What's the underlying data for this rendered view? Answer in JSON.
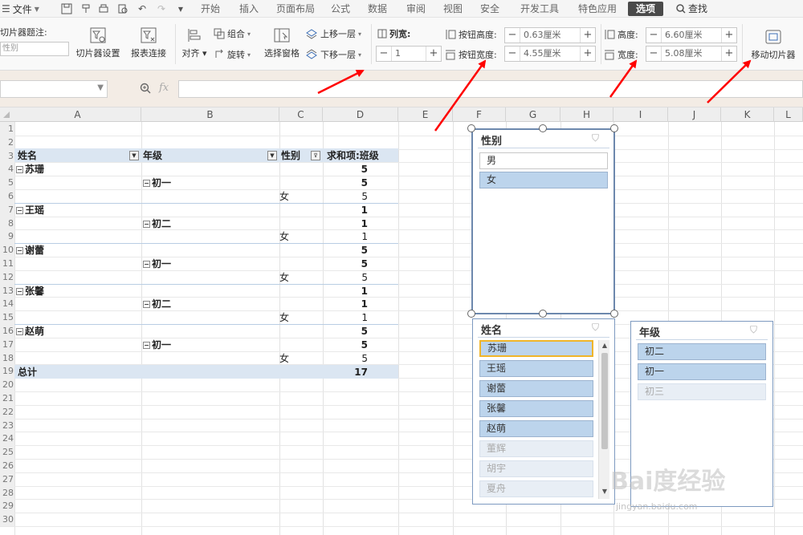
{
  "menubar": {
    "file_label": "文件",
    "tabs": [
      "开始",
      "插入",
      "页面布局",
      "公式",
      "数据",
      "审阅",
      "视图",
      "安全",
      "开发工具",
      "特色应用",
      "选项"
    ],
    "active_tab": "选项",
    "search_label": "查找"
  },
  "ribbon": {
    "caption_label": "切片器题注:",
    "caption_value": "性别",
    "slicer_settings": "切片器设置",
    "report_connections": "报表连接",
    "align": "对齐",
    "group": "组合",
    "rotate": "旋转",
    "selection_pane": "选择窗格",
    "bring_forward": "上移一层",
    "send_backward": "下移一层",
    "columns_label": "列宽:",
    "columns_value": "1",
    "button_height_label": "按钮高度:",
    "button_height_value": "0.63厘米",
    "button_width_label": "按钮宽度:",
    "button_width_value": "4.55厘米",
    "height_label": "高度:",
    "height_value": "6.60厘米",
    "width_label": "宽度:",
    "width_value": "5.08厘米",
    "move_slicer": "移动切片器"
  },
  "formula_bar": {
    "fx": "fx",
    "value": ""
  },
  "columns": [
    "A",
    "B",
    "C",
    "D",
    "E",
    "F",
    "G",
    "H",
    "I",
    "J",
    "K",
    "L"
  ],
  "rows": [
    "1",
    "2",
    "3",
    "4",
    "5",
    "6",
    "7",
    "8",
    "9",
    "10",
    "11",
    "12",
    "13",
    "14",
    "15",
    "16",
    "17",
    "18",
    "19",
    "20",
    "21",
    "22",
    "23",
    "24",
    "25",
    "26",
    "27",
    "28",
    "29",
    "30"
  ],
  "pivot": {
    "headers": [
      "姓名",
      "年级",
      "性别",
      "求和项:班级"
    ],
    "names": [
      {
        "name": "苏珊",
        "total": "5",
        "grade": "初一",
        "grade_total": "5",
        "gender": "女",
        "value": "5"
      },
      {
        "name": "王瑶",
        "total": "1",
        "grade": "初二",
        "grade_total": "1",
        "gender": "女",
        "value": "1"
      },
      {
        "name": "谢蕾",
        "total": "5",
        "grade": "初一",
        "grade_total": "5",
        "gender": "女",
        "value": "5"
      },
      {
        "name": "张馨",
        "total": "1",
        "grade": "初二",
        "grade_total": "1",
        "gender": "女",
        "value": "1"
      },
      {
        "name": "赵萌",
        "total": "5",
        "grade": "初一",
        "grade_total": "5",
        "gender": "女",
        "value": "5"
      }
    ],
    "total_label": "总计",
    "total_value": "17"
  },
  "slicers": {
    "gender": {
      "title": "性别",
      "items": [
        "男",
        "女"
      ]
    },
    "name": {
      "title": "姓名",
      "items": [
        "苏珊",
        "王瑶",
        "谢蕾",
        "张馨",
        "赵萌",
        "董辉",
        "胡宇",
        "夏舟"
      ]
    },
    "grade": {
      "title": "年级",
      "items": [
        "初二",
        "初一",
        "初三"
      ]
    }
  },
  "colors": {
    "accent": "#4a4a4a",
    "selected": "#bcd4ec",
    "header_fill": "#dbe6f2",
    "arrow": "#ff0000"
  },
  "watermark": {
    "main": "Bai度经验",
    "sub": "jingyan.baidu.com"
  }
}
